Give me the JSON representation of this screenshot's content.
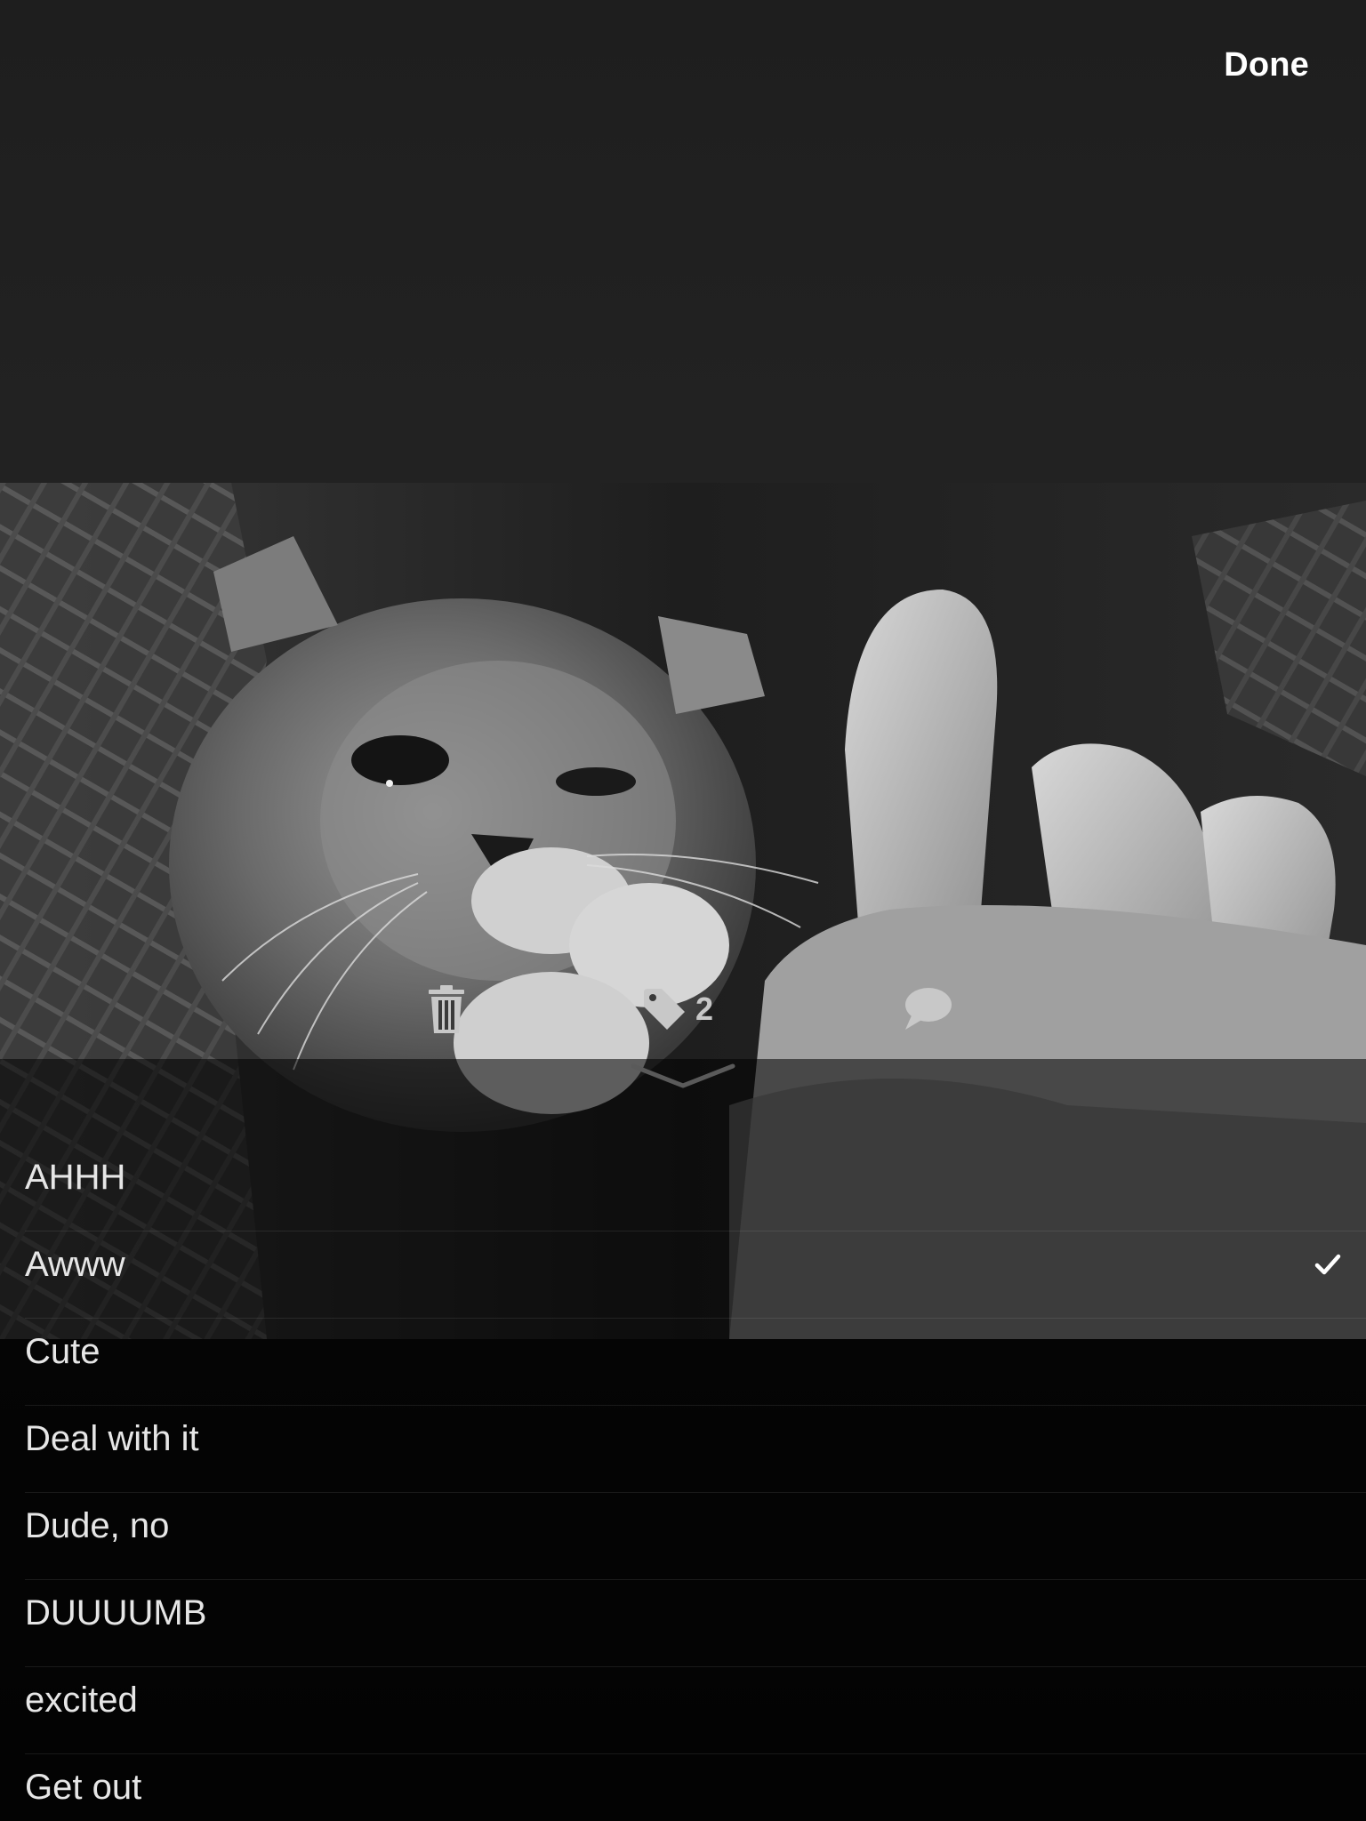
{
  "header": {
    "done_label": "Done"
  },
  "photo": {
    "subject": "kitten-with-hand",
    "style": "grayscale"
  },
  "actions": {
    "trash_icon": "trash-icon",
    "tag_icon": "tag-icon",
    "tag_count": "2",
    "comment_icon": "speech-bubble-icon"
  },
  "tags": [
    {
      "label": "AHHH",
      "selected": false
    },
    {
      "label": "Awww",
      "selected": true
    },
    {
      "label": "Cute",
      "selected": false
    },
    {
      "label": "Deal with it",
      "selected": false
    },
    {
      "label": "Dude, no",
      "selected": false
    },
    {
      "label": "DUUUUMB",
      "selected": false
    },
    {
      "label": "excited",
      "selected": false
    },
    {
      "label": "Get out",
      "selected": false
    }
  ],
  "colors": {
    "text": "#e6e6e6",
    "accent": "#ffffff",
    "icon": "#c8c8c8"
  }
}
